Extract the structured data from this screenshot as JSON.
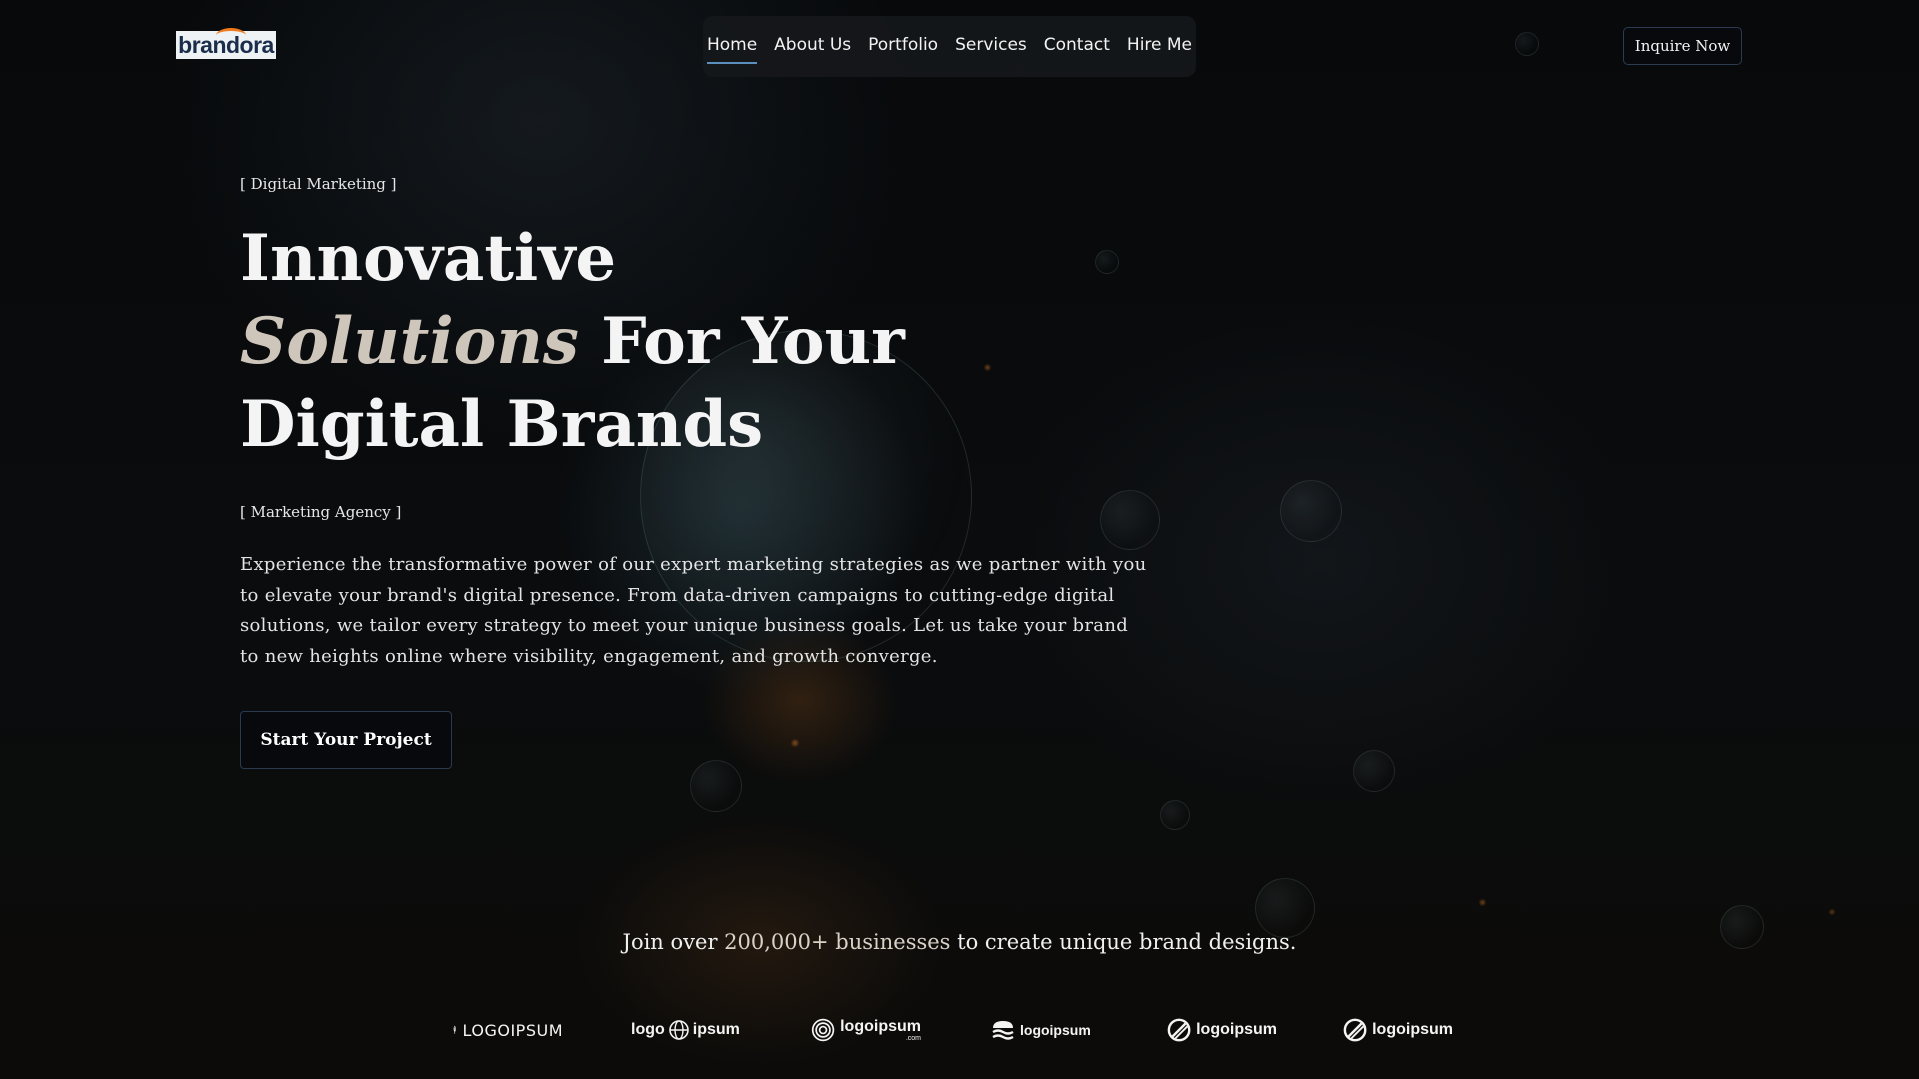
{
  "brand": {
    "logo_text": "brandora"
  },
  "nav": {
    "items": [
      {
        "label": "Home",
        "active": true
      },
      {
        "label": "About Us"
      },
      {
        "label": "Portfolio"
      },
      {
        "label": "Services"
      },
      {
        "label": "Contact"
      },
      {
        "label": "Hire Me"
      }
    ],
    "cta_label": "Inquire Now"
  },
  "hero": {
    "tag": "[ Digital Marketing ]",
    "headline": {
      "line1": "Innovative",
      "line2_italic": "Solutions",
      "line2_rest": " For Your",
      "line3": "Digital Brands"
    },
    "subtag": "[ Marketing Agency ]",
    "description": "Experience the transformative power of our expert marketing strategies as we partner with you to elevate your brand's digital presence. From data-driven campaigns to cutting-edge digital solutions, we tailor every strategy to meet your unique business goals. Let us take your brand to new heights online where visibility, engagement, and growth converge.",
    "button_label": "Start Your Project"
  },
  "social_proof": {
    "prefix": "Join over ",
    "highlight": "200,000+ businesses",
    "suffix": " to create unique brand designs."
  },
  "clients": {
    "logos": [
      {
        "text": "LOGOIPSUM",
        "icon": "feather-icon"
      },
      {
        "text_a": "logo",
        "text_b": "ipsum",
        "icon": "globe-icon"
      },
      {
        "text": "logoipsum",
        "sub": ".com",
        "icon": "spiral-icon"
      },
      {
        "text": "logoipsum",
        "icon": "waves-icon"
      },
      {
        "text": "logoipsum",
        "icon": "slashed-circle-icon"
      },
      {
        "text": "logoipsum",
        "icon": "slashed-circle-icon"
      }
    ]
  }
}
